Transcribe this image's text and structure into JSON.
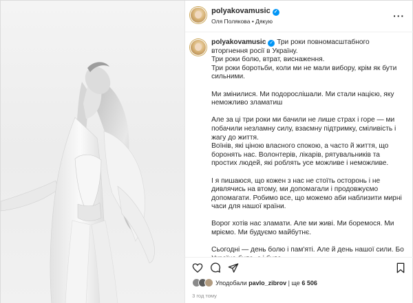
{
  "post": {
    "username": "polyakovamusic",
    "subline": "Оля Полякова • Дякую",
    "caption_username": "polyakovamusic",
    "paragraphs": [
      "Три роки повномасштабного вторгнення росії в Україну.",
      "Три роки болю, втрат, виснаження.",
      "Три роки боротьби, коли ми не мали вибору, крім як бути сильними.",
      "Ми змінилися. Ми подорослішали. Ми стали нацією, яку неможливо зламатиш",
      "Але за ці три роки ми бачили не лише страх і горе — ми побачили незламну силу, взаємну підтримку, сміливість і жагу до життя.",
      "Воїнів, які ціною власного спокою, а часто й життя, що боронять нас. Волонтерів, лікарів, рятувальників та простих людей, які роблять усе можливе і неможливе.",
      "І я пишаюся, що кожен з нас не стоїть осторонь і не дивлячись на втому, ми допомагали і продовжуємо допомагати. Робимо все, що можемо аби наблизити мирні часи для нашої країни.",
      "Ворог хотів нас зламати. Але ми живі. Ми боремося. Ми мріємо. Ми будуємо майбутнє.",
      "Сьогодні — день болю і пам'яті. Але й день нашої сили. Бо Україна була, є і буде."
    ],
    "likes_prefix": "Уподобали",
    "liked_by": "pavlo_zibrov",
    "likes_joiner": "| ще",
    "likes_count": "6 506",
    "time": "3 год тому"
  },
  "icons": {
    "more": "more-options-icon",
    "verified": "verified-badge-icon",
    "like": "heart-icon",
    "comment": "comment-icon",
    "share": "share-icon",
    "save": "bookmark-icon"
  },
  "colors": {
    "verified": "#0095f6",
    "muted": "#8e8e8e",
    "text": "#262626"
  }
}
